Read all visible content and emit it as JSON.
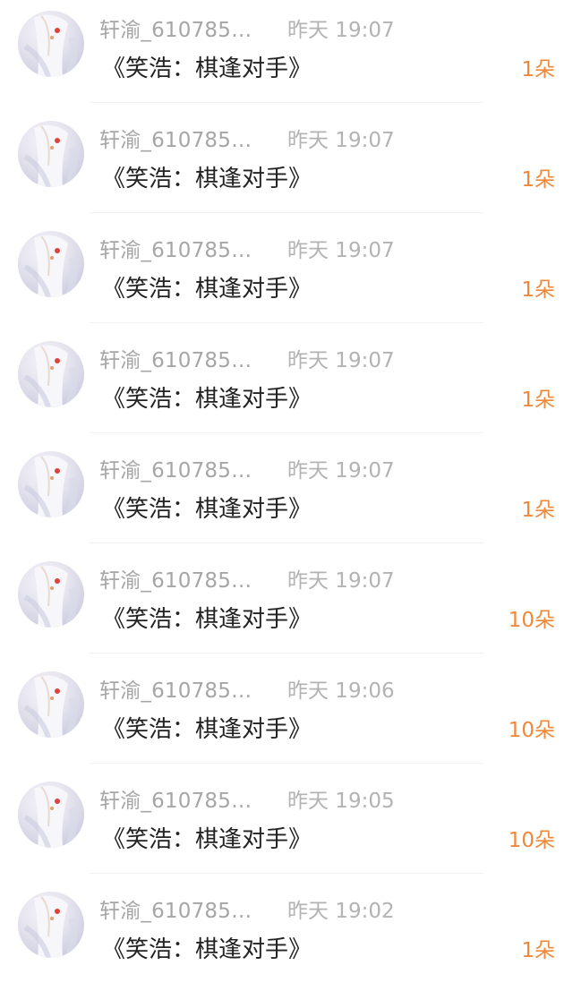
{
  "records": [
    {
      "user": "轩渝_610785…",
      "time": "昨天 19:07",
      "item": "《笑浩：棋逢对手》",
      "count": "1朵"
    },
    {
      "user": "轩渝_610785…",
      "time": "昨天 19:07",
      "item": "《笑浩：棋逢对手》",
      "count": "1朵"
    },
    {
      "user": "轩渝_610785…",
      "time": "昨天 19:07",
      "item": "《笑浩：棋逢对手》",
      "count": "1朵"
    },
    {
      "user": "轩渝_610785…",
      "time": "昨天 19:07",
      "item": "《笑浩：棋逢对手》",
      "count": "1朵"
    },
    {
      "user": "轩渝_610785…",
      "time": "昨天 19:07",
      "item": "《笑浩：棋逢对手》",
      "count": "1朵"
    },
    {
      "user": "轩渝_610785…",
      "time": "昨天 19:07",
      "item": "《笑浩：棋逢对手》",
      "count": "10朵"
    },
    {
      "user": "轩渝_610785…",
      "time": "昨天 19:06",
      "item": "《笑浩：棋逢对手》",
      "count": "10朵"
    },
    {
      "user": "轩渝_610785…",
      "time": "昨天 19:05",
      "item": "《笑浩：棋逢对手》",
      "count": "10朵"
    },
    {
      "user": "轩渝_610785…",
      "time": "昨天 19:02",
      "item": "《笑浩：棋逢对手》",
      "count": "1朵"
    }
  ],
  "colors": {
    "accent": "#f0883a",
    "muted": "#a6a6a6",
    "text": "#222222"
  },
  "icons": {
    "avatar": "user-avatar-illustration"
  }
}
